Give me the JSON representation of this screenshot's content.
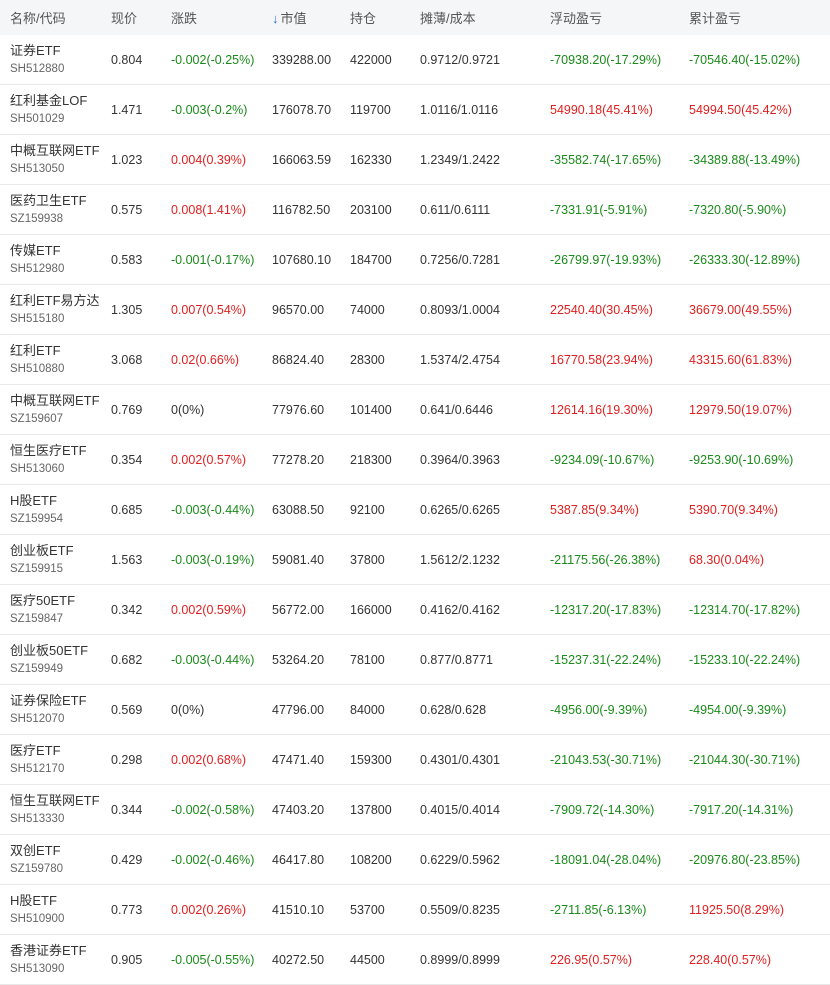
{
  "colors": {
    "up": "#e02020",
    "down": "#1a8a1a",
    "flat": "#333333",
    "header_bg": "#f5f6f8",
    "sort_arrow": "#2a6fd6"
  },
  "header": {
    "name_code": "名称/代码",
    "price": "现价",
    "change": "涨跌",
    "sort_arrow": "↓",
    "market_value": "市值",
    "position": "持仓",
    "cost": "摊薄/成本",
    "floating_pl": "浮动盈亏",
    "cumulative_pl": "累计盈亏"
  },
  "rows": [
    {
      "name": "证券ETF",
      "code": "SH512880",
      "price": "0.804",
      "change": "-0.002(-0.25%)",
      "change_dir": "down",
      "market_value": "339288.00",
      "position": "422000",
      "cost": "0.9712/0.9721",
      "floating_pl": "-70938.20(-17.29%)",
      "floating_dir": "down",
      "cumulative_pl": "-70546.40(-15.02%)",
      "cumulative_dir": "down"
    },
    {
      "name": "红利基金LOF",
      "code": "SH501029",
      "price": "1.471",
      "change": "-0.003(-0.2%)",
      "change_dir": "down",
      "market_value": "176078.70",
      "position": "119700",
      "cost": "1.0116/1.0116",
      "floating_pl": "54990.18(45.41%)",
      "floating_dir": "up",
      "cumulative_pl": "54994.50(45.42%)",
      "cumulative_dir": "up"
    },
    {
      "name": "中概互联网ETF",
      "code": "SH513050",
      "price": "1.023",
      "change": "0.004(0.39%)",
      "change_dir": "up",
      "market_value": "166063.59",
      "position": "162330",
      "cost": "1.2349/1.2422",
      "floating_pl": "-35582.74(-17.65%)",
      "floating_dir": "down",
      "cumulative_pl": "-34389.88(-13.49%)",
      "cumulative_dir": "down"
    },
    {
      "name": "医药卫生ETF",
      "code": "SZ159938",
      "price": "0.575",
      "change": "0.008(1.41%)",
      "change_dir": "up",
      "market_value": "116782.50",
      "position": "203100",
      "cost": "0.611/0.6111",
      "floating_pl": "-7331.91(-5.91%)",
      "floating_dir": "down",
      "cumulative_pl": "-7320.80(-5.90%)",
      "cumulative_dir": "down"
    },
    {
      "name": "传媒ETF",
      "code": "SH512980",
      "price": "0.583",
      "change": "-0.001(-0.17%)",
      "change_dir": "down",
      "market_value": "107680.10",
      "position": "184700",
      "cost": "0.7256/0.7281",
      "floating_pl": "-26799.97(-19.93%)",
      "floating_dir": "down",
      "cumulative_pl": "-26333.30(-12.89%)",
      "cumulative_dir": "down"
    },
    {
      "name": "红利ETF易方达",
      "code": "SH515180",
      "price": "1.305",
      "change": "0.007(0.54%)",
      "change_dir": "up",
      "market_value": "96570.00",
      "position": "74000",
      "cost": "0.8093/1.0004",
      "floating_pl": "22540.40(30.45%)",
      "floating_dir": "up",
      "cumulative_pl": "36679.00(49.55%)",
      "cumulative_dir": "up"
    },
    {
      "name": "红利ETF",
      "code": "SH510880",
      "price": "3.068",
      "change": "0.02(0.66%)",
      "change_dir": "up",
      "market_value": "86824.40",
      "position": "28300",
      "cost": "1.5374/2.4754",
      "floating_pl": "16770.58(23.94%)",
      "floating_dir": "up",
      "cumulative_pl": "43315.60(61.83%)",
      "cumulative_dir": "up"
    },
    {
      "name": "中概互联网ETF",
      "code": "SZ159607",
      "price": "0.769",
      "change": "0(0%)",
      "change_dir": "flat",
      "market_value": "77976.60",
      "position": "101400",
      "cost": "0.641/0.6446",
      "floating_pl": "12614.16(19.30%)",
      "floating_dir": "up",
      "cumulative_pl": "12979.50(19.07%)",
      "cumulative_dir": "up"
    },
    {
      "name": "恒生医疗ETF",
      "code": "SH513060",
      "price": "0.354",
      "change": "0.002(0.57%)",
      "change_dir": "up",
      "market_value": "77278.20",
      "position": "218300",
      "cost": "0.3964/0.3963",
      "floating_pl": "-9234.09(-10.67%)",
      "floating_dir": "down",
      "cumulative_pl": "-9253.90(-10.69%)",
      "cumulative_dir": "down"
    },
    {
      "name": "H股ETF",
      "code": "SZ159954",
      "price": "0.685",
      "change": "-0.003(-0.44%)",
      "change_dir": "down",
      "market_value": "63088.50",
      "position": "92100",
      "cost": "0.6265/0.6265",
      "floating_pl": "5387.85(9.34%)",
      "floating_dir": "up",
      "cumulative_pl": "5390.70(9.34%)",
      "cumulative_dir": "up"
    },
    {
      "name": "创业板ETF",
      "code": "SZ159915",
      "price": "1.563",
      "change": "-0.003(-0.19%)",
      "change_dir": "down",
      "market_value": "59081.40",
      "position": "37800",
      "cost": "1.5612/2.1232",
      "floating_pl": "-21175.56(-26.38%)",
      "floating_dir": "down",
      "cumulative_pl": "68.30(0.04%)",
      "cumulative_dir": "up"
    },
    {
      "name": "医疗50ETF",
      "code": "SZ159847",
      "price": "0.342",
      "change": "0.002(0.59%)",
      "change_dir": "up",
      "market_value": "56772.00",
      "position": "166000",
      "cost": "0.4162/0.4162",
      "floating_pl": "-12317.20(-17.83%)",
      "floating_dir": "down",
      "cumulative_pl": "-12314.70(-17.82%)",
      "cumulative_dir": "down"
    },
    {
      "name": "创业板50ETF",
      "code": "SZ159949",
      "price": "0.682",
      "change": "-0.003(-0.44%)",
      "change_dir": "down",
      "market_value": "53264.20",
      "position": "78100",
      "cost": "0.877/0.8771",
      "floating_pl": "-15237.31(-22.24%)",
      "floating_dir": "down",
      "cumulative_pl": "-15233.10(-22.24%)",
      "cumulative_dir": "down"
    },
    {
      "name": "证券保险ETF",
      "code": "SH512070",
      "price": "0.569",
      "change": "0(0%)",
      "change_dir": "flat",
      "market_value": "47796.00",
      "position": "84000",
      "cost": "0.628/0.628",
      "floating_pl": "-4956.00(-9.39%)",
      "floating_dir": "down",
      "cumulative_pl": "-4954.00(-9.39%)",
      "cumulative_dir": "down"
    },
    {
      "name": "医疗ETF",
      "code": "SH512170",
      "price": "0.298",
      "change": "0.002(0.68%)",
      "change_dir": "up",
      "market_value": "47471.40",
      "position": "159300",
      "cost": "0.4301/0.4301",
      "floating_pl": "-21043.53(-30.71%)",
      "floating_dir": "down",
      "cumulative_pl": "-21044.30(-30.71%)",
      "cumulative_dir": "down"
    },
    {
      "name": "恒生互联网ETF",
      "code": "SH513330",
      "price": "0.344",
      "change": "-0.002(-0.58%)",
      "change_dir": "down",
      "market_value": "47403.20",
      "position": "137800",
      "cost": "0.4015/0.4014",
      "floating_pl": "-7909.72(-14.30%)",
      "floating_dir": "down",
      "cumulative_pl": "-7917.20(-14.31%)",
      "cumulative_dir": "down"
    },
    {
      "name": "双创ETF",
      "code": "SZ159780",
      "price": "0.429",
      "change": "-0.002(-0.46%)",
      "change_dir": "down",
      "market_value": "46417.80",
      "position": "108200",
      "cost": "0.6229/0.5962",
      "floating_pl": "-18091.04(-28.04%)",
      "floating_dir": "down",
      "cumulative_pl": "-20976.80(-23.85%)",
      "cumulative_dir": "down"
    },
    {
      "name": "H股ETF",
      "code": "SH510900",
      "price": "0.773",
      "change": "0.002(0.26%)",
      "change_dir": "up",
      "market_value": "41510.10",
      "position": "53700",
      "cost": "0.5509/0.8235",
      "floating_pl": "-2711.85(-6.13%)",
      "floating_dir": "down",
      "cumulative_pl": "11925.50(8.29%)",
      "cumulative_dir": "up"
    },
    {
      "name": "香港证券ETF",
      "code": "SH513090",
      "price": "0.905",
      "change": "-0.005(-0.55%)",
      "change_dir": "down",
      "market_value": "40272.50",
      "position": "44500",
      "cost": "0.8999/0.8999",
      "floating_pl": "226.95(0.57%)",
      "floating_dir": "up",
      "cumulative_pl": "228.40(0.57%)",
      "cumulative_dir": "up"
    }
  ]
}
